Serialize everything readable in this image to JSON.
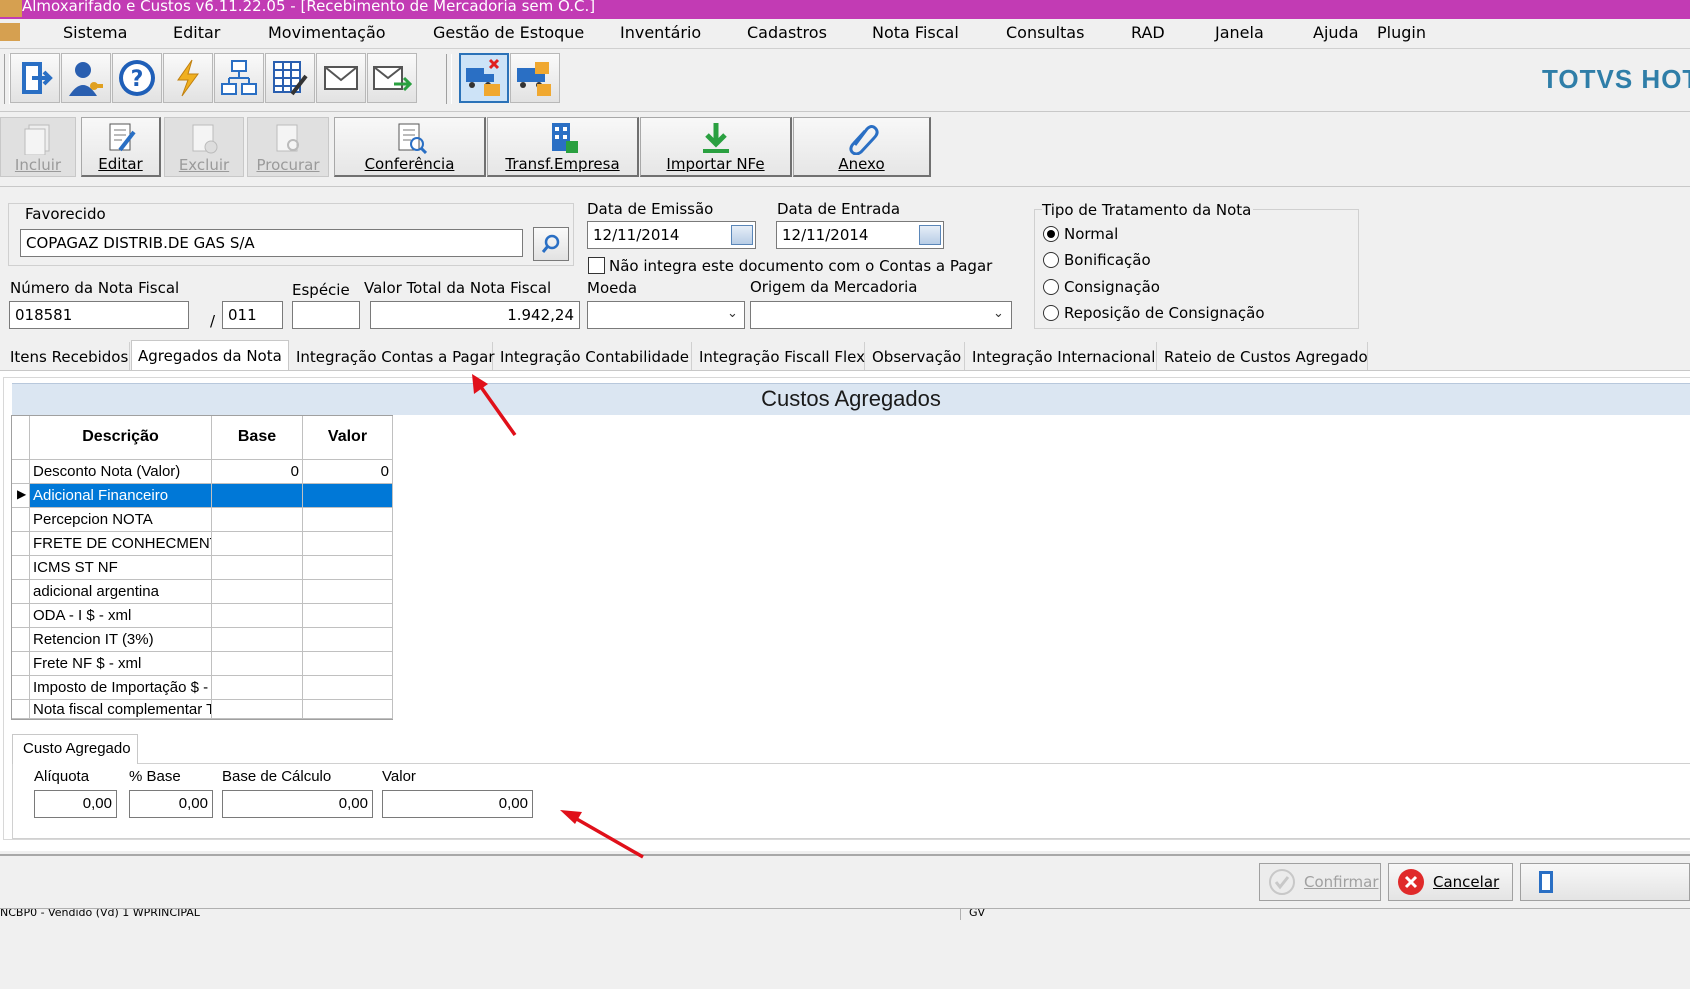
{
  "window": {
    "title": "Almoxarifado e Custos v6.11.22.05 - [Recebimento de Mercadoria sem O.C.]"
  },
  "menu": [
    "Sistema",
    "Editar",
    "Movimentação",
    "Gestão de Estoque",
    "Inventário",
    "Cadastros",
    "Nota Fiscal",
    "Consultas",
    "RAD",
    "Janela",
    "Ajuda",
    "Plugin"
  ],
  "brand": "TOTVS HOTÉ",
  "toolbar_actions": {
    "incluir": "Incluir",
    "editar": "Editar",
    "excluir": "Excluir",
    "procurar": "Procurar",
    "conferencia": "Conferência",
    "transf_empresa": "Transf.Empresa",
    "importar_nfe": "Importar NFe",
    "anexo": "Anexo"
  },
  "form": {
    "favorecido_label": "Favorecido",
    "favorecido_value": "COPAGAZ DISTRIB.DE GAS S/A",
    "data_emissao_label": "Data de Emissão",
    "data_emissao_value": "12/11/2014",
    "data_entrada_label": "Data de Entrada",
    "data_entrada_value": "12/11/2014",
    "nao_integra_label": "Não integra este documento com o Contas a Pagar",
    "numero_nf_label": "Número da Nota Fiscal",
    "numero_nf_value": "018581",
    "serie_sep": "/",
    "serie_value": "011",
    "especie_label": "Espécie",
    "especie_value": "",
    "valor_total_label": "Valor Total da Nota Fiscal",
    "valor_total_value": "1.942,24",
    "moeda_label": "Moeda",
    "origem_label": "Origem da Mercadoria"
  },
  "tipo_tratamento": {
    "label": "Tipo de Tratamento da Nota",
    "options": [
      "Normal",
      "Bonificação",
      "Consignação",
      "Reposição de Consignação"
    ],
    "selected": "Normal"
  },
  "tabs": [
    "Itens Recebidos",
    "Agregados da Nota",
    "Integração Contas a Pagar",
    "Integração Contabilidade",
    "Integração Fiscall Flex",
    "Observação",
    "Integração Internacional",
    "Rateio de Custos Agregado"
  ],
  "active_tab": "Agregados da Nota",
  "custos": {
    "heading": "Custos Agregados",
    "columns": [
      "Descrição",
      "Base",
      "Valor"
    ],
    "rows": [
      {
        "descricao": "Desconto Nota (Valor)",
        "base": "0",
        "valor": "0"
      },
      {
        "descricao": "Adicional Financeiro",
        "base": "",
        "valor": ""
      },
      {
        "descricao": "Percepcion NOTA",
        "base": "",
        "valor": ""
      },
      {
        "descricao": "FRETE DE CONHECMENT",
        "base": "",
        "valor": ""
      },
      {
        "descricao": "ICMS ST NF",
        "base": "",
        "valor": ""
      },
      {
        "descricao": "adicional argentina",
        "base": "",
        "valor": ""
      },
      {
        "descricao": "ODA - I $ - xml",
        "base": "",
        "valor": ""
      },
      {
        "descricao": "Retencion IT (3%)",
        "base": "",
        "valor": ""
      },
      {
        "descricao": "Frete NF $ - xml",
        "base": "",
        "valor": ""
      },
      {
        "descricao": "Imposto de Importação $ - :",
        "base": "",
        "valor": ""
      },
      {
        "descricao": "Nota fiscal complementar T",
        "base": "",
        "valor": ""
      }
    ],
    "selected_row": 1
  },
  "custo_agregado": {
    "tab_label": "Custo Agregado",
    "aliquota_label": "Alíquota",
    "aliquota_value": "0,00",
    "pct_base_label": "% Base",
    "pct_base_value": "0,00",
    "base_calculo_label": "Base de Cálculo",
    "base_calculo_value": "0,00",
    "valor_label": "Valor",
    "valor_value": "0,00"
  },
  "buttons": {
    "confirmar": "Confirmar",
    "cancelar": "Cancelar"
  },
  "status": {
    "left": "NCBP0 - Vendido (Vd) 1 WPRINCIPAL",
    "right": "GV"
  },
  "colors": {
    "title_bar": "#c23bb4",
    "selection": "#0078d7",
    "annotation_arrow": "#e0101a",
    "brand": "#2f7ea8"
  }
}
